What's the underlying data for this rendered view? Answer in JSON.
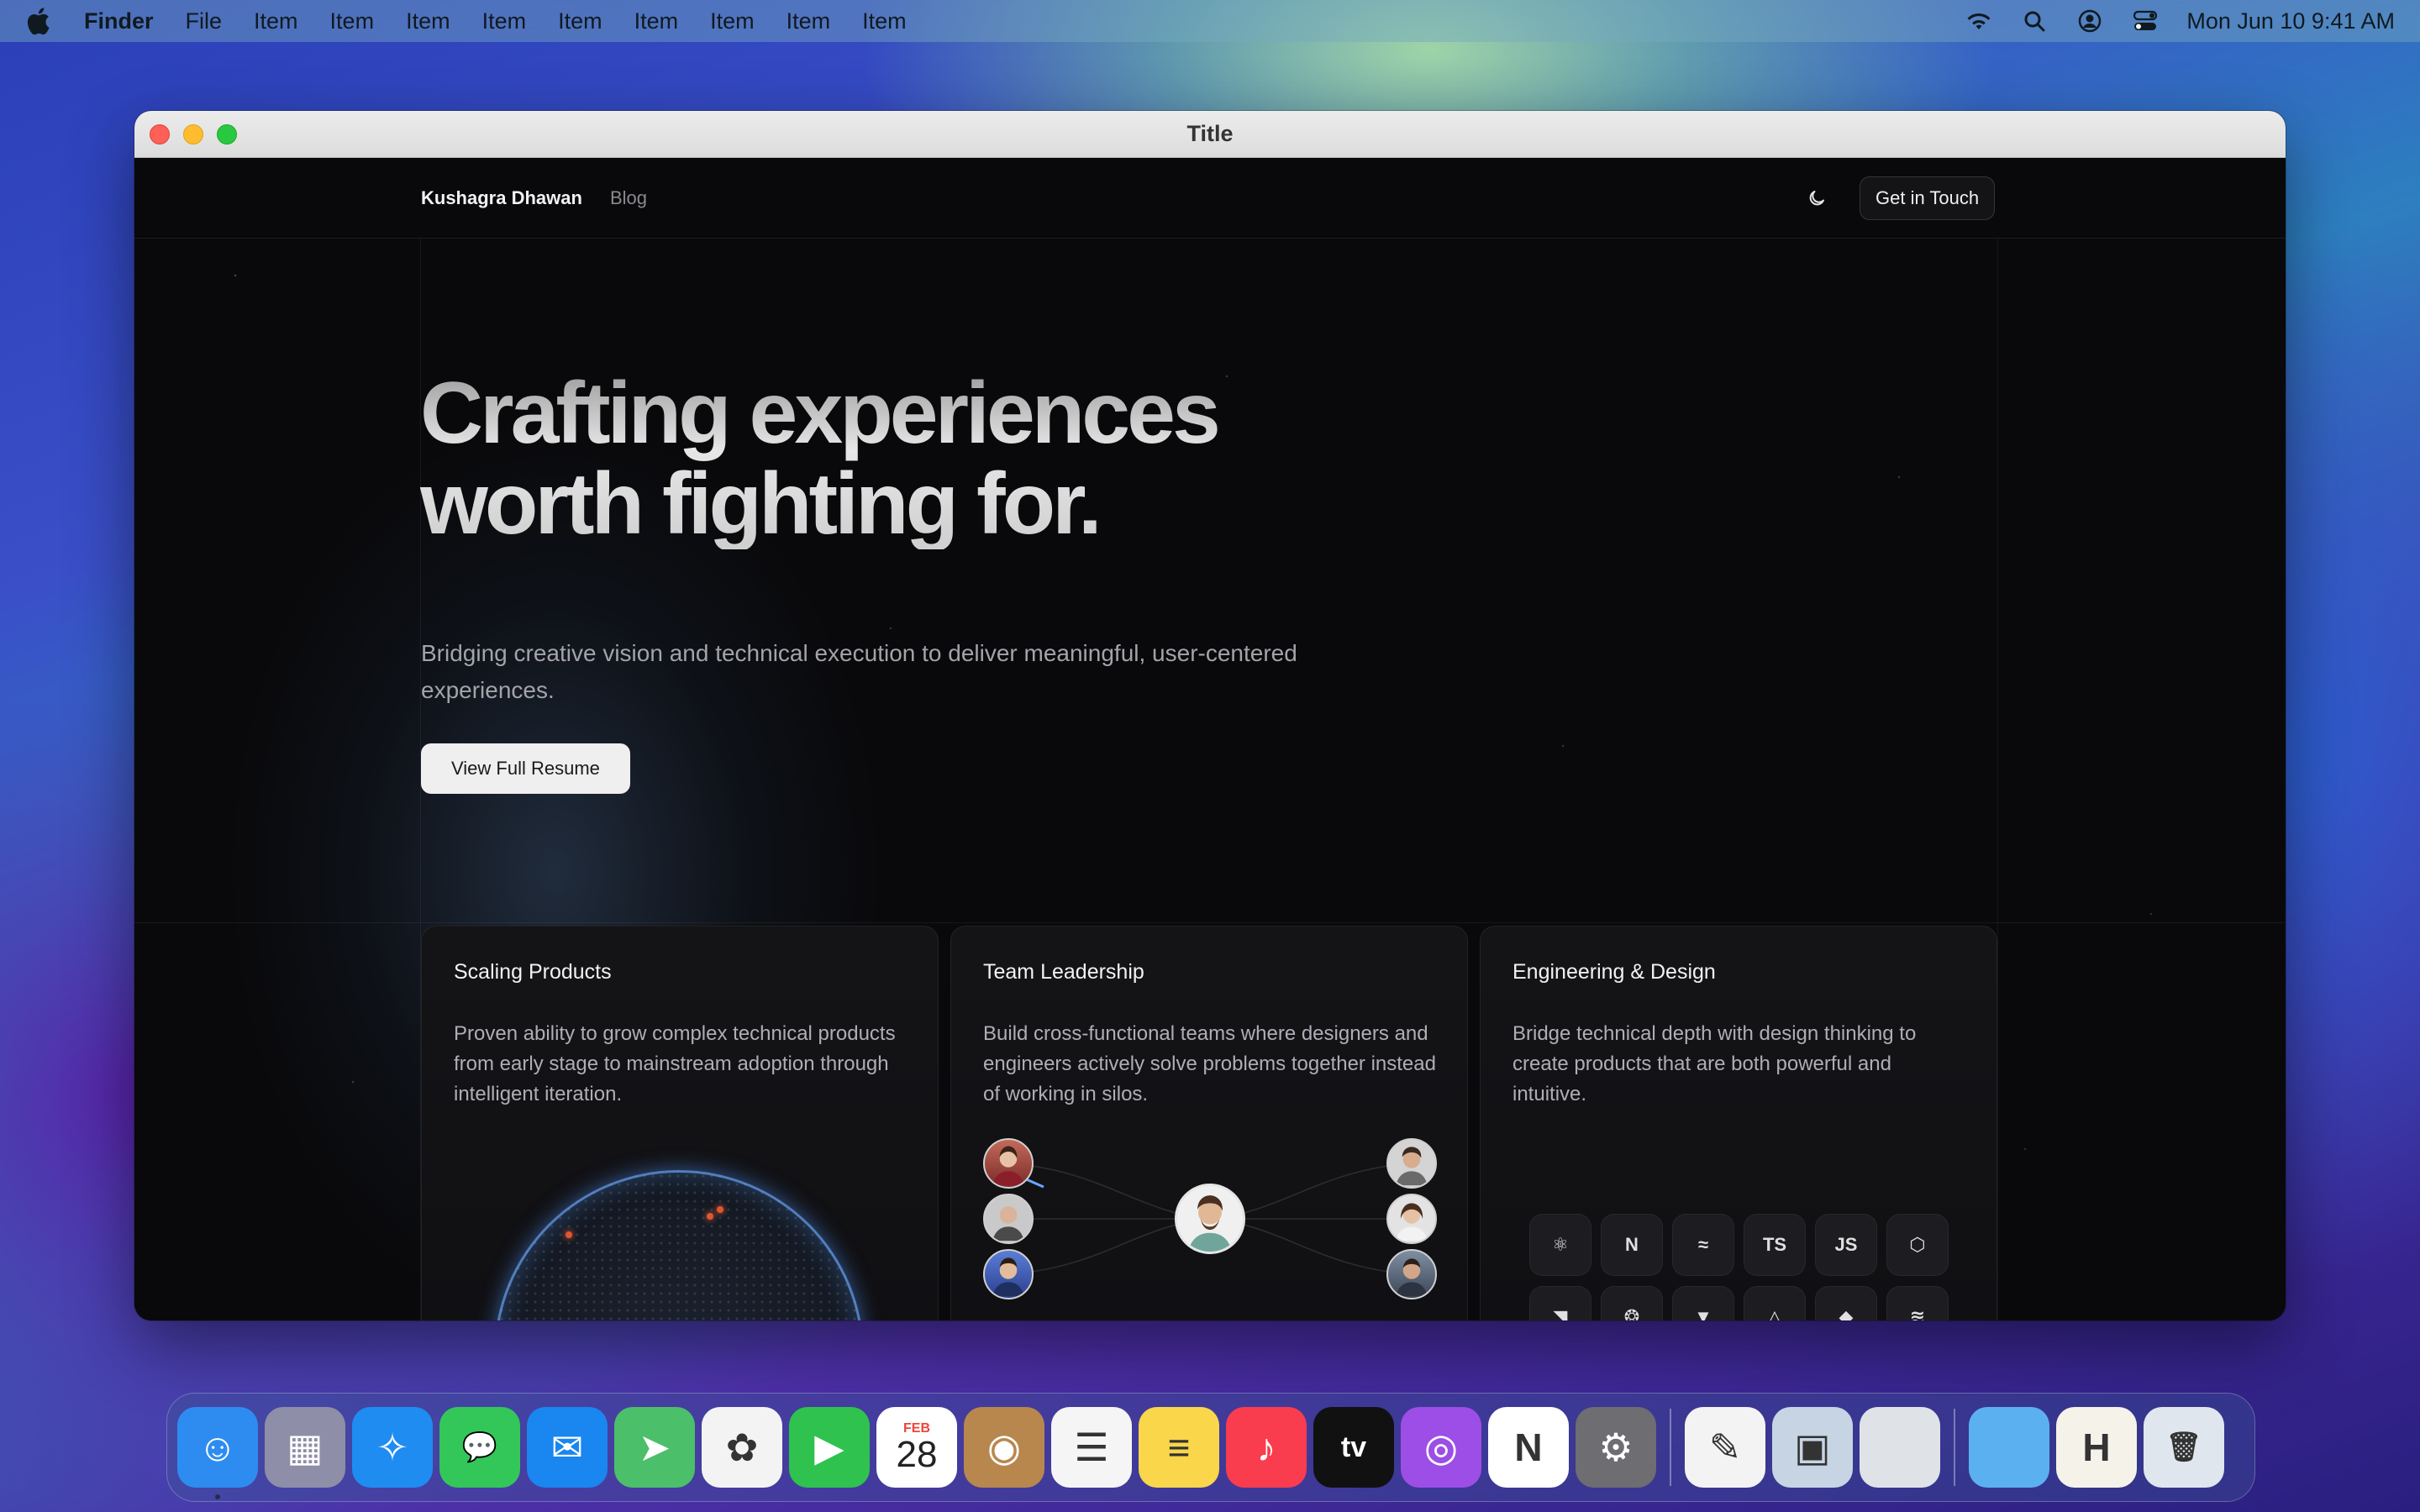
{
  "menubar": {
    "app_name": "Finder",
    "items": [
      "File",
      "Item",
      "Item",
      "Item",
      "Item",
      "Item",
      "Item",
      "Item",
      "Item",
      "Item"
    ],
    "datetime": "Mon Jun 10  9:41 AM",
    "status_icons": [
      "wifi-icon",
      "search-icon",
      "user-icon",
      "control-center-icon"
    ]
  },
  "window": {
    "title": "Title"
  },
  "site": {
    "nav": {
      "brand": "Kushagra Dhawan",
      "blog": "Blog",
      "cta": "Get in Touch"
    },
    "hero": {
      "title_line1": "Crafting experiences",
      "title_line2": "worth fighting for.",
      "subtitle_line1": "Bridging creative vision and technical execution to deliver meaningful, user-centered",
      "subtitle_line2": "experiences.",
      "button": "View Full Resume"
    },
    "cards": [
      {
        "title": "Scaling Products",
        "description": "Proven ability to grow complex technical products from early stage to mainstream adoption through intelligent iteration."
      },
      {
        "title": "Team Leadership",
        "description": "Build cross-functional teams where designers and engineers actively solve problems together instead of working in silos."
      },
      {
        "title": "Engineering & Design",
        "description": "Bridge technical depth with design thinking to create products that are both powerful and intuitive."
      }
    ],
    "tech_icons": [
      {
        "name": "react-icon",
        "glyph": "⚛"
      },
      {
        "name": "nextjs-icon",
        "glyph": "N"
      },
      {
        "name": "tailwind-icon",
        "glyph": "≈"
      },
      {
        "name": "typescript-icon",
        "glyph": "TS"
      },
      {
        "name": "javascript-icon",
        "glyph": "JS"
      },
      {
        "name": "nodejs-icon",
        "glyph": "⬡"
      },
      {
        "name": "framer-icon",
        "glyph": "◥"
      },
      {
        "name": "graphql-icon",
        "glyph": "❂"
      },
      {
        "name": "vue-icon",
        "glyph": "▼"
      },
      {
        "name": "prisma-icon",
        "glyph": "△"
      },
      {
        "name": "mongodb-icon",
        "glyph": "◆"
      },
      {
        "name": "docker-icon",
        "glyph": "≋"
      }
    ]
  },
  "dock": {
    "apps": [
      {
        "name": "finder-icon",
        "color": "#2e8cf0",
        "running": true,
        "glyph": "☺"
      },
      {
        "name": "launchpad-icon",
        "color": "#8e8ea8",
        "glyph": "▦"
      },
      {
        "name": "safari-icon",
        "color": "#1f8cf2",
        "glyph": "✧"
      },
      {
        "name": "messages-icon",
        "color": "#33c759",
        "glyph": "💬"
      },
      {
        "name": "mail-icon",
        "color": "#1a86f0",
        "glyph": "✉"
      },
      {
        "name": "maps-icon",
        "color": "#4cbf6a",
        "glyph": "➤"
      },
      {
        "name": "photos-icon",
        "color": "#f3f3f3",
        "glyph": "✿"
      },
      {
        "name": "facetime-icon",
        "color": "#2fc24e",
        "glyph": "▶"
      },
      {
        "name": "calendar-icon",
        "color": "#ffffff",
        "glyph": "28",
        "month": "FEB"
      },
      {
        "name": "contacts-icon",
        "color": "#b8874e",
        "glyph": "◉"
      },
      {
        "name": "reminders-icon",
        "color": "#f5f5f5",
        "glyph": "☰"
      },
      {
        "name": "notes-icon",
        "color": "#f9d64a",
        "glyph": "≡"
      },
      {
        "name": "music-icon",
        "color": "#fa3c4f",
        "glyph": "♪"
      },
      {
        "name": "tv-icon",
        "color": "#111111",
        "glyph": "tv"
      },
      {
        "name": "podcasts-icon",
        "color": "#9c4ee6",
        "glyph": "◎"
      },
      {
        "name": "news-icon",
        "color": "#ffffff",
        "glyph": "N"
      },
      {
        "name": "system-settings-icon",
        "color": "#6d6d72",
        "glyph": "⚙"
      },
      {
        "separator": true
      },
      {
        "name": "textedit-icon",
        "color": "#f3f3f3",
        "glyph": "✎"
      },
      {
        "name": "preview-icon",
        "color": "#c7d4e4",
        "glyph": "▣"
      },
      {
        "name": "blank-app-icon",
        "color": "#dfe3e8",
        "glyph": ""
      },
      {
        "separator": true
      },
      {
        "name": "folder-icon",
        "color": "#5bb0f0",
        "glyph": ""
      },
      {
        "name": "document-icon",
        "color": "#f5f2ea",
        "glyph": "H"
      },
      {
        "name": "trash-icon",
        "color": "#dfe6ee",
        "glyph": "🗑"
      }
    ]
  }
}
